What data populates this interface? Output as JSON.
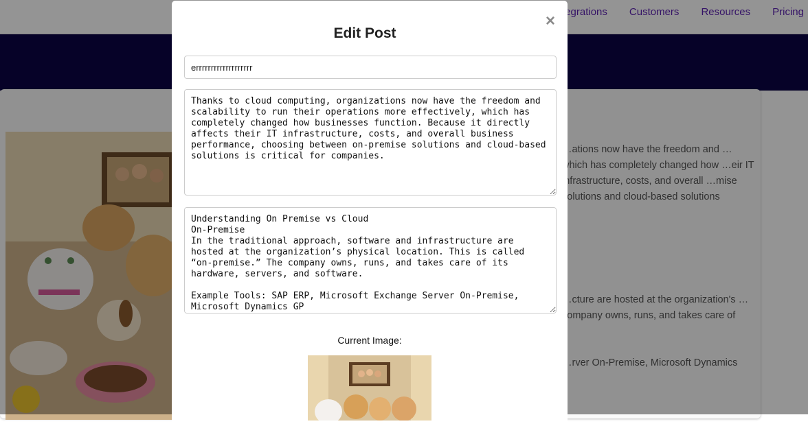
{
  "nav": {
    "items": [
      "Integrations",
      "Customers",
      "Resources",
      "Pricing"
    ]
  },
  "background_text": {
    "para1": "…ations now have the freedom and … which has completely changed how …eir IT infrastructure, costs, and overall …mise solutions and cloud-based solutions",
    "para2": "…cture are hosted at the organization's … company owns, runs, and takes care of",
    "para3": "…rver On-Premise, Microsoft Dynamics"
  },
  "modal": {
    "close_label": "×",
    "title": "Edit Post",
    "title_value": "errrrrrrrrrrrrrrrrrr",
    "excerpt_value": "Thanks to cloud computing, organizations now have the freedom and scalability to run their operations more effectively, which has completely changed how businesses function. Because it directly affects their IT infrastructure, costs, and overall business performance, choosing between on-premise solutions and cloud-based solutions is critical for companies.",
    "content_value": "Understanding On Premise vs Cloud\nOn-Premise\nIn the traditional approach, software and infrastructure are hosted at the organization’s physical location. This is called “on-premise.” The company owns, runs, and takes care of its hardware, servers, and software.\n\nExample Tools: SAP ERP, Microsoft Exchange Server On-Premise, Microsoft Dynamics GP",
    "current_image_label": "Current Image:"
  },
  "colors": {
    "nav_link": "#5b1fb0",
    "hero_band": "#0b0546",
    "overlay": "rgba(0,0,0,0.42)"
  }
}
